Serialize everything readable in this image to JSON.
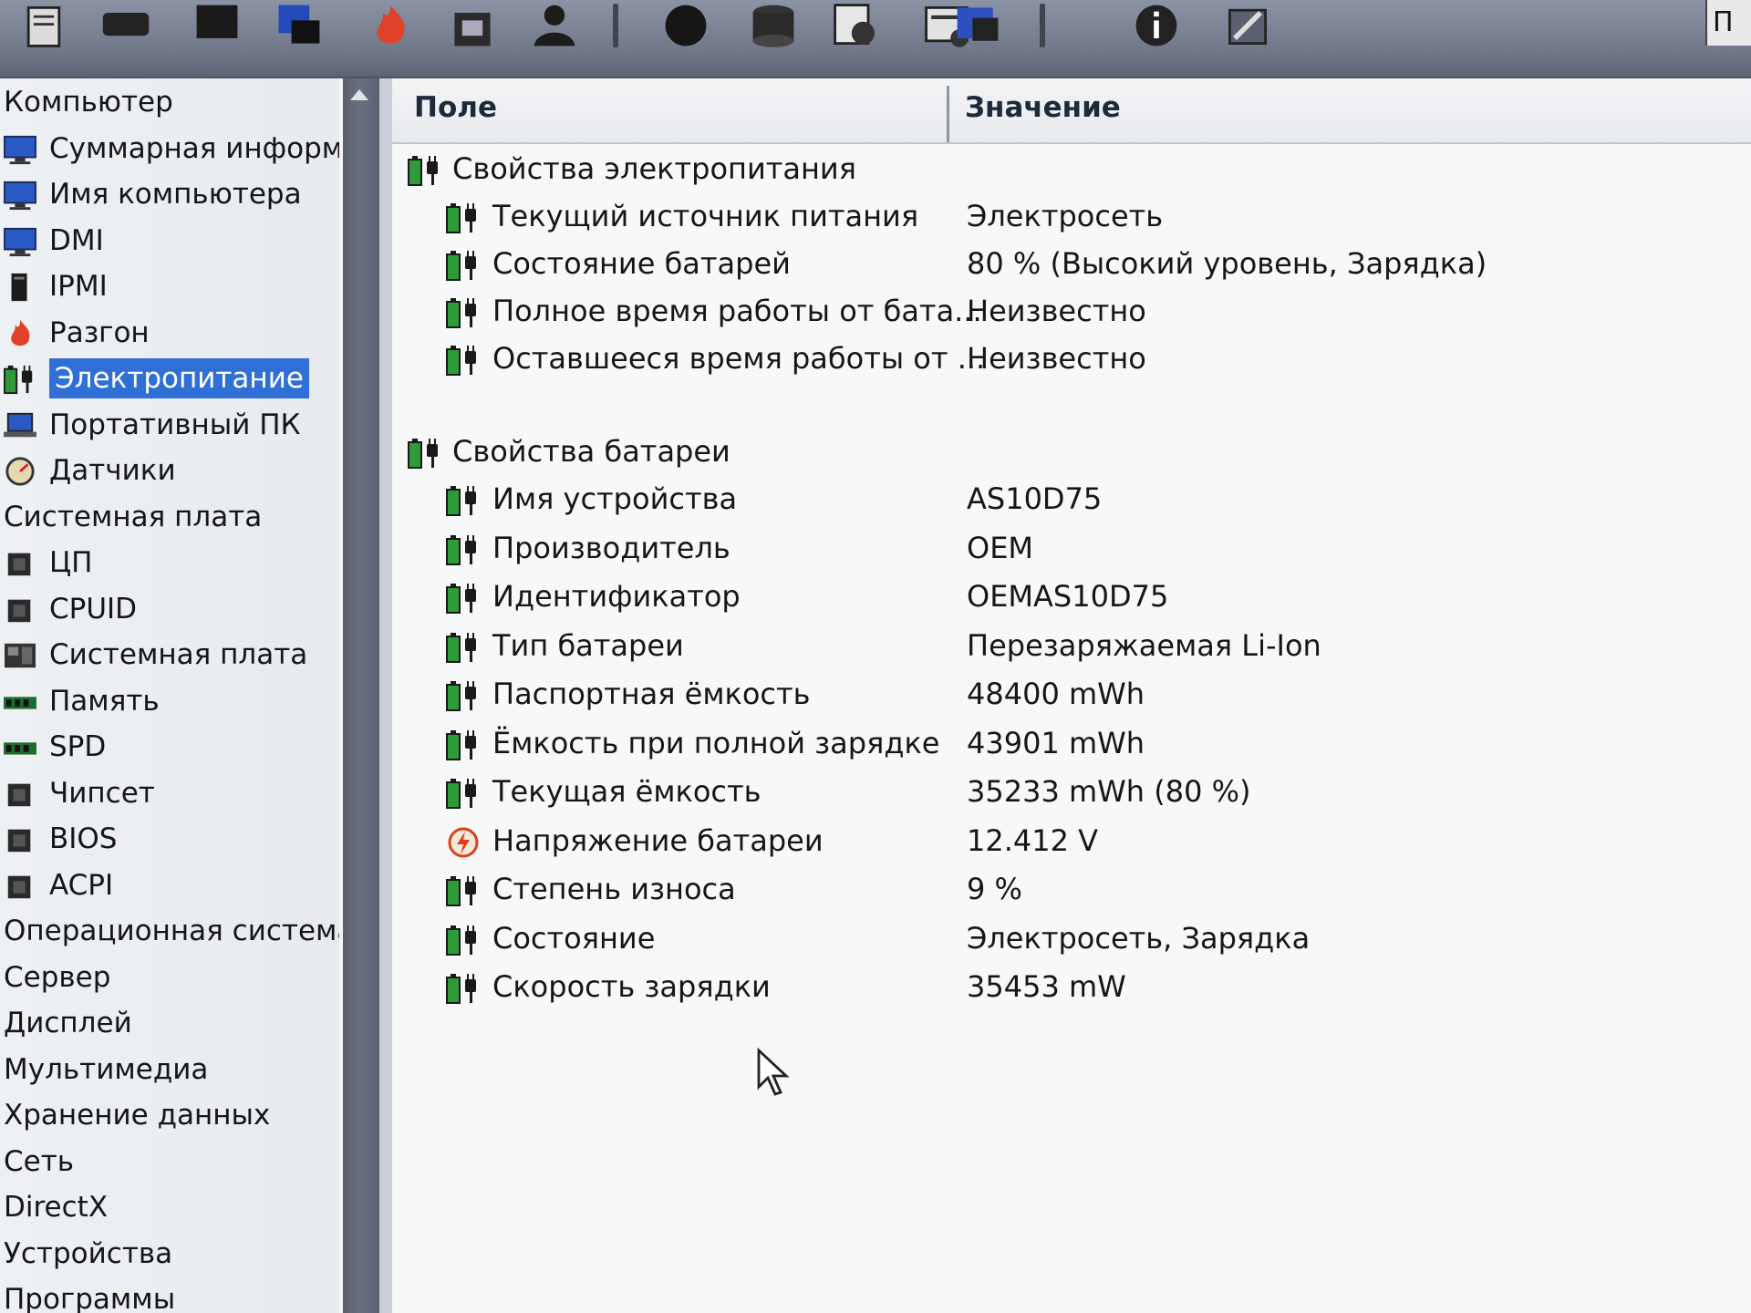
{
  "toolbar": {
    "icons": [
      "report-icon",
      "motherboard-icon",
      "computer-icon",
      "windows-icon",
      "overclock-flame-icon",
      "benchmark-icon",
      "user-icon",
      "cpu-icon",
      "database-icon",
      "gpgpu-icon",
      "network-icon",
      "display-icon",
      "info-icon",
      "tools-icon"
    ],
    "right_edge": "П"
  },
  "sidebar": {
    "items": [
      {
        "label": "Компьютер",
        "kind": "category",
        "icon": ""
      },
      {
        "label": "Суммарная информ",
        "kind": "item",
        "icon": "monitor-icon"
      },
      {
        "label": "Имя компьютера",
        "kind": "item",
        "icon": "monitor-icon"
      },
      {
        "label": "DMI",
        "kind": "item",
        "icon": "monitor-icon"
      },
      {
        "label": "IPMI",
        "kind": "item",
        "icon": "server-icon"
      },
      {
        "label": "Разгон",
        "kind": "item",
        "icon": "flame-icon"
      },
      {
        "label": "Электропитание",
        "kind": "item",
        "icon": "battery-plug-icon",
        "selected": true
      },
      {
        "label": "Портативный ПК",
        "kind": "item",
        "icon": "laptop-icon"
      },
      {
        "label": "Датчики",
        "kind": "item",
        "icon": "gauge-icon"
      },
      {
        "label": "Системная плата",
        "kind": "category",
        "icon": ""
      },
      {
        "label": "ЦП",
        "kind": "item",
        "icon": "chip-icon"
      },
      {
        "label": "CPUID",
        "kind": "item",
        "icon": "chip-icon"
      },
      {
        "label": "Системная плата",
        "kind": "item",
        "icon": "motherboard-icon"
      },
      {
        "label": "Память",
        "kind": "item",
        "icon": "memory-icon"
      },
      {
        "label": "SPD",
        "kind": "item",
        "icon": "memory-icon"
      },
      {
        "label": "Чипсет",
        "kind": "item",
        "icon": "chip-icon"
      },
      {
        "label": "BIOS",
        "kind": "item",
        "icon": "chip-icon"
      },
      {
        "label": "ACPI",
        "kind": "item",
        "icon": "chip-icon"
      },
      {
        "label": "Операционная система",
        "kind": "category",
        "icon": ""
      },
      {
        "label": "Сервер",
        "kind": "category",
        "icon": ""
      },
      {
        "label": "Дисплей",
        "kind": "category",
        "icon": ""
      },
      {
        "label": "Мультимедиа",
        "kind": "category",
        "icon": ""
      },
      {
        "label": "Хранение данных",
        "kind": "category",
        "icon": ""
      },
      {
        "label": "Сеть",
        "kind": "category",
        "icon": ""
      },
      {
        "label": "DirectX",
        "kind": "category",
        "icon": ""
      },
      {
        "label": "Устройства",
        "kind": "category",
        "icon": ""
      },
      {
        "label": "Программы",
        "kind": "category",
        "icon": ""
      }
    ]
  },
  "table": {
    "columns": {
      "field": "Поле",
      "value": "Значение"
    },
    "groups": [
      {
        "title": "Свойства электропитания",
        "rows": [
          {
            "field": "Текущий источник питания",
            "value": "Электросеть",
            "icon": "battery-plug-icon"
          },
          {
            "field": "Состояние батарей",
            "value": "80 % (Высокий уровень, Зарядка)",
            "icon": "battery-plug-icon"
          },
          {
            "field": "Полное время работы от бата...",
            "value": "Неизвестно",
            "icon": "battery-plug-icon"
          },
          {
            "field": "Оставшееся время работы от ...",
            "value": "Неизвестно",
            "icon": "battery-plug-icon"
          }
        ]
      },
      {
        "title": "Свойства батареи",
        "rows": [
          {
            "field": "Имя устройства",
            "value": "AS10D75",
            "icon": "battery-plug-icon"
          },
          {
            "field": "Производитель",
            "value": "OEM",
            "icon": "battery-plug-icon"
          },
          {
            "field": "Идентификатор",
            "value": "OEMAS10D75",
            "icon": "battery-plug-icon"
          },
          {
            "field": "Тип батареи",
            "value": "Перезаряжаемая Li-Ion",
            "icon": "battery-plug-icon"
          },
          {
            "field": "Паспортная ёмкость",
            "value": "48400 mWh",
            "icon": "battery-plug-icon"
          },
          {
            "field": "Ёмкость при полной зарядке",
            "value": "43901 mWh",
            "icon": "battery-plug-icon"
          },
          {
            "field": "Текущая ёмкость",
            "value": "35233 mWh  (80 %)",
            "icon": "battery-plug-icon"
          },
          {
            "field": "Напряжение батареи",
            "value": "12.412 V",
            "icon": "voltage-icon"
          },
          {
            "field": "Степень износа",
            "value": "9 %",
            "icon": "battery-plug-icon"
          },
          {
            "field": "Состояние",
            "value": "Электросеть, Зарядка",
            "icon": "battery-plug-icon"
          },
          {
            "field": "Скорость зарядки",
            "value": "35453 mW",
            "icon": "battery-plug-icon"
          }
        ]
      }
    ]
  },
  "colors": {
    "selection": "#2f6fd6",
    "battery_green": "#2f9a3a",
    "toolbar": "#7a8192"
  }
}
